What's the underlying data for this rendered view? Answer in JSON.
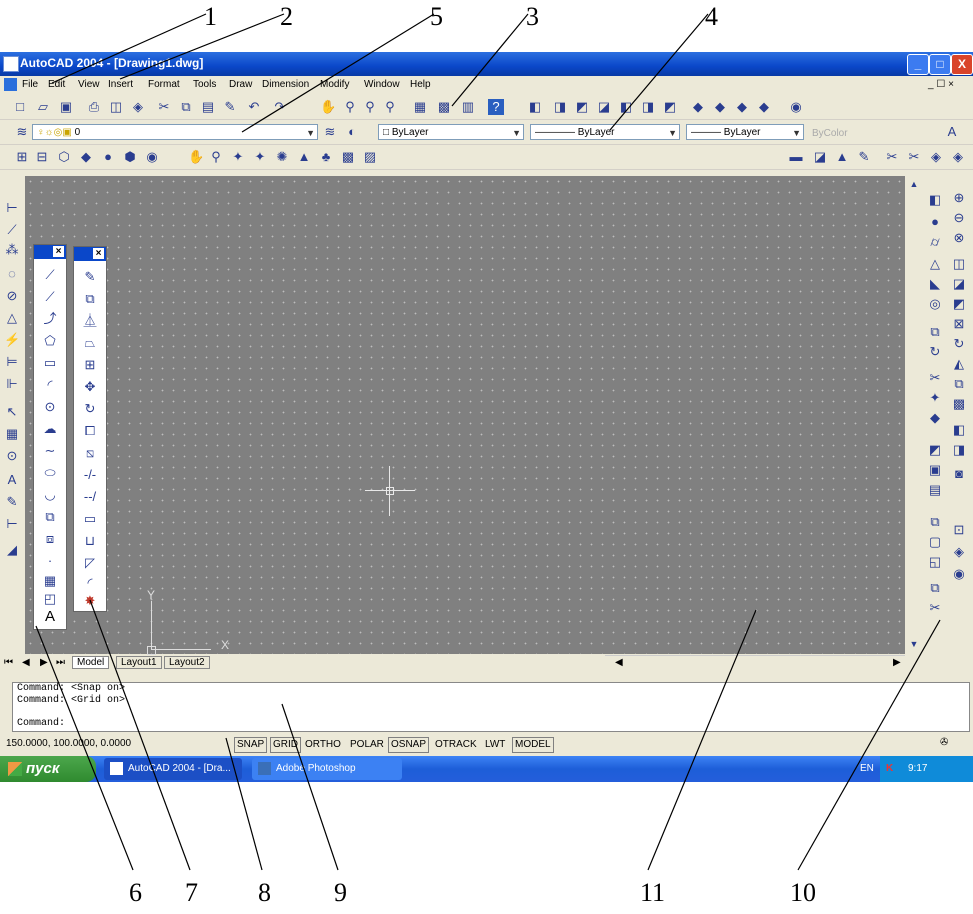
{
  "callouts": [
    "1",
    "2",
    "5",
    "3",
    "4",
    "6",
    "7",
    "8",
    "9",
    "11",
    "10"
  ],
  "window": {
    "title": "AutoCAD 2004 - [Drawing1.dwg]",
    "min": "_",
    "max": "□",
    "close": "X"
  },
  "menu": {
    "items": [
      "File",
      "Edit",
      "View",
      "Insert",
      "Format",
      "Tools",
      "Draw",
      "Dimension",
      "Modify",
      "Window",
      "Help"
    ],
    "doc_controls": "_ ☐ ×"
  },
  "properties": {
    "layer": "0",
    "color": "ByLayer",
    "linetype": "ByLayer",
    "lineweight": "ByLayer",
    "plotstyle": "ByColor"
  },
  "tabs": {
    "model": "Model",
    "layout1": "Layout1",
    "layout2": "Layout2"
  },
  "ucs": {
    "x": "X",
    "y": "Y"
  },
  "command_lines": [
    "Command:  <Snap on>",
    "Command:  <Grid on>",
    "Command:"
  ],
  "status": {
    "coords": "150.0000, 100.0000, 0.0000",
    "buttons": [
      "SNAP",
      "GRID",
      "ORTHO",
      "POLAR",
      "OSNAP",
      "OTRACK",
      "LWT",
      "MODEL"
    ]
  },
  "taskbar": {
    "start": "пуск",
    "task1": "AutoCAD 2004 - [Dra...",
    "task2": "Adobe Photoshop",
    "lang": "EN",
    "clock": "9:17"
  },
  "colors": {
    "titlebar": "#0a47c9",
    "drawing_bg": "#808080",
    "taskbar": "#245edb",
    "start": "#2f8a2f"
  },
  "icons": {
    "draw_toolbar": [
      "line-icon",
      "construction-line-icon",
      "polyline-icon",
      "polygon-icon",
      "rectangle-icon",
      "arc-icon",
      "circle-icon",
      "revision-cloud-icon",
      "spline-icon",
      "ellipse-icon",
      "ellipse-arc-icon",
      "insert-block-icon",
      "make-block-icon",
      "point-icon",
      "hatch-icon",
      "region-icon",
      "mtext-icon"
    ],
    "modify_toolbar": [
      "erase-icon",
      "copy-icon",
      "mirror-icon",
      "offset-icon",
      "array-icon",
      "move-icon",
      "rotate-icon",
      "scale-icon",
      "stretch-icon",
      "trim-icon",
      "extend-icon",
      "break-icon",
      "join-icon",
      "chamfer-icon",
      "fillet-icon",
      "explode-icon"
    ]
  }
}
